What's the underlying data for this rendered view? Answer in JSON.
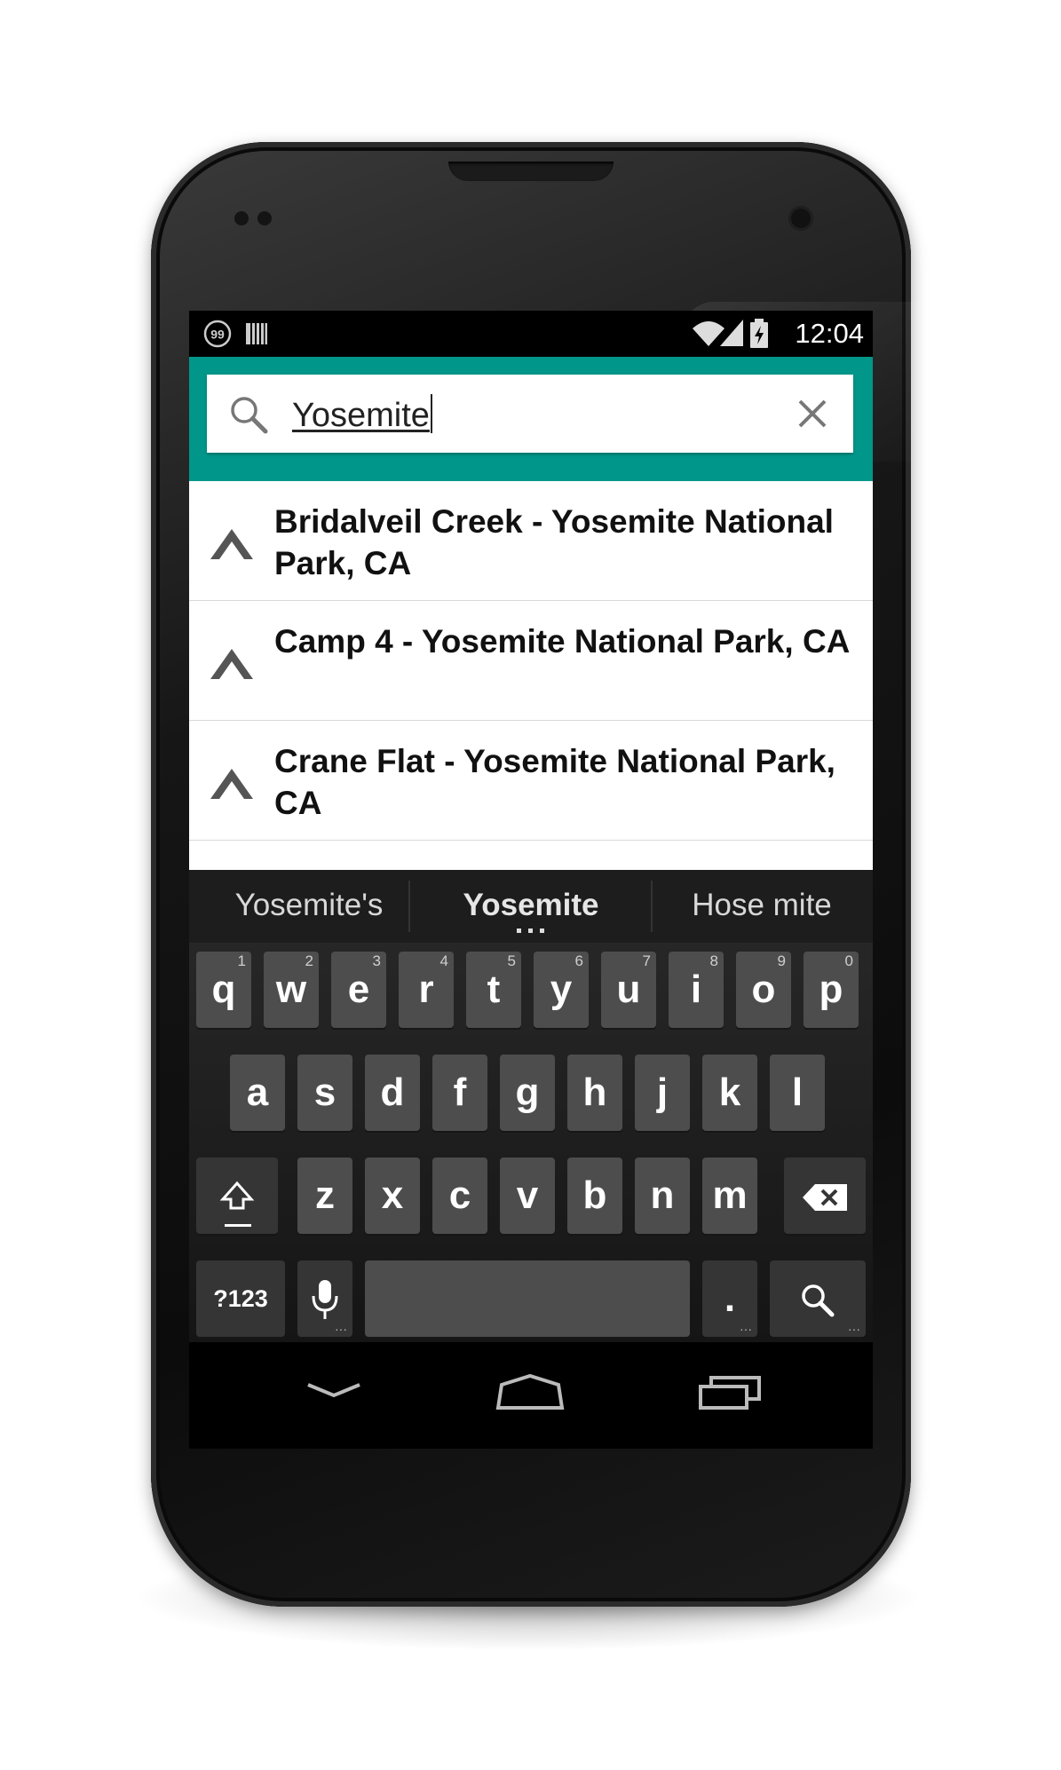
{
  "status_bar": {
    "time": "12:04",
    "left_icons": [
      "notification-99-icon",
      "barcode-icon"
    ],
    "right_icons": [
      "wifi-icon",
      "signal-icon",
      "battery-charging-icon"
    ],
    "notification_badge": "99"
  },
  "search": {
    "query": "Yosemite",
    "icon": "search-icon",
    "clear_icon": "close-icon",
    "header_color": "#00978a"
  },
  "results": [
    {
      "label": "Bridalveil Creek - Yosemite National Park, CA",
      "icon": "tent-icon"
    },
    {
      "label": "Camp 4 - Yosemite National Park, CA",
      "icon": "tent-icon"
    },
    {
      "label": "Crane Flat - Yosemite National Park, CA",
      "icon": "tent-icon"
    }
  ],
  "keyboard": {
    "suggestions": [
      "Yosemite's",
      "Yosemite",
      "Hose mite"
    ],
    "row1": [
      {
        "key": "q",
        "num": "1"
      },
      {
        "key": "w",
        "num": "2"
      },
      {
        "key": "e",
        "num": "3"
      },
      {
        "key": "r",
        "num": "4"
      },
      {
        "key": "t",
        "num": "5"
      },
      {
        "key": "y",
        "num": "6"
      },
      {
        "key": "u",
        "num": "7"
      },
      {
        "key": "i",
        "num": "8"
      },
      {
        "key": "o",
        "num": "9"
      },
      {
        "key": "p",
        "num": "0"
      }
    ],
    "row2": [
      "a",
      "s",
      "d",
      "f",
      "g",
      "h",
      "j",
      "k",
      "l"
    ],
    "row3": [
      "z",
      "x",
      "c",
      "v",
      "b",
      "n",
      "m"
    ],
    "symbols_label": "?123",
    "period_label": ".",
    "shift_icon": "shift-icon",
    "backspace_icon": "backspace-icon",
    "mic_icon": "mic-icon",
    "search_key_icon": "search-icon"
  },
  "nav_bar": {
    "icons": [
      "back-chevron-icon",
      "home-icon",
      "recents-icon"
    ]
  }
}
